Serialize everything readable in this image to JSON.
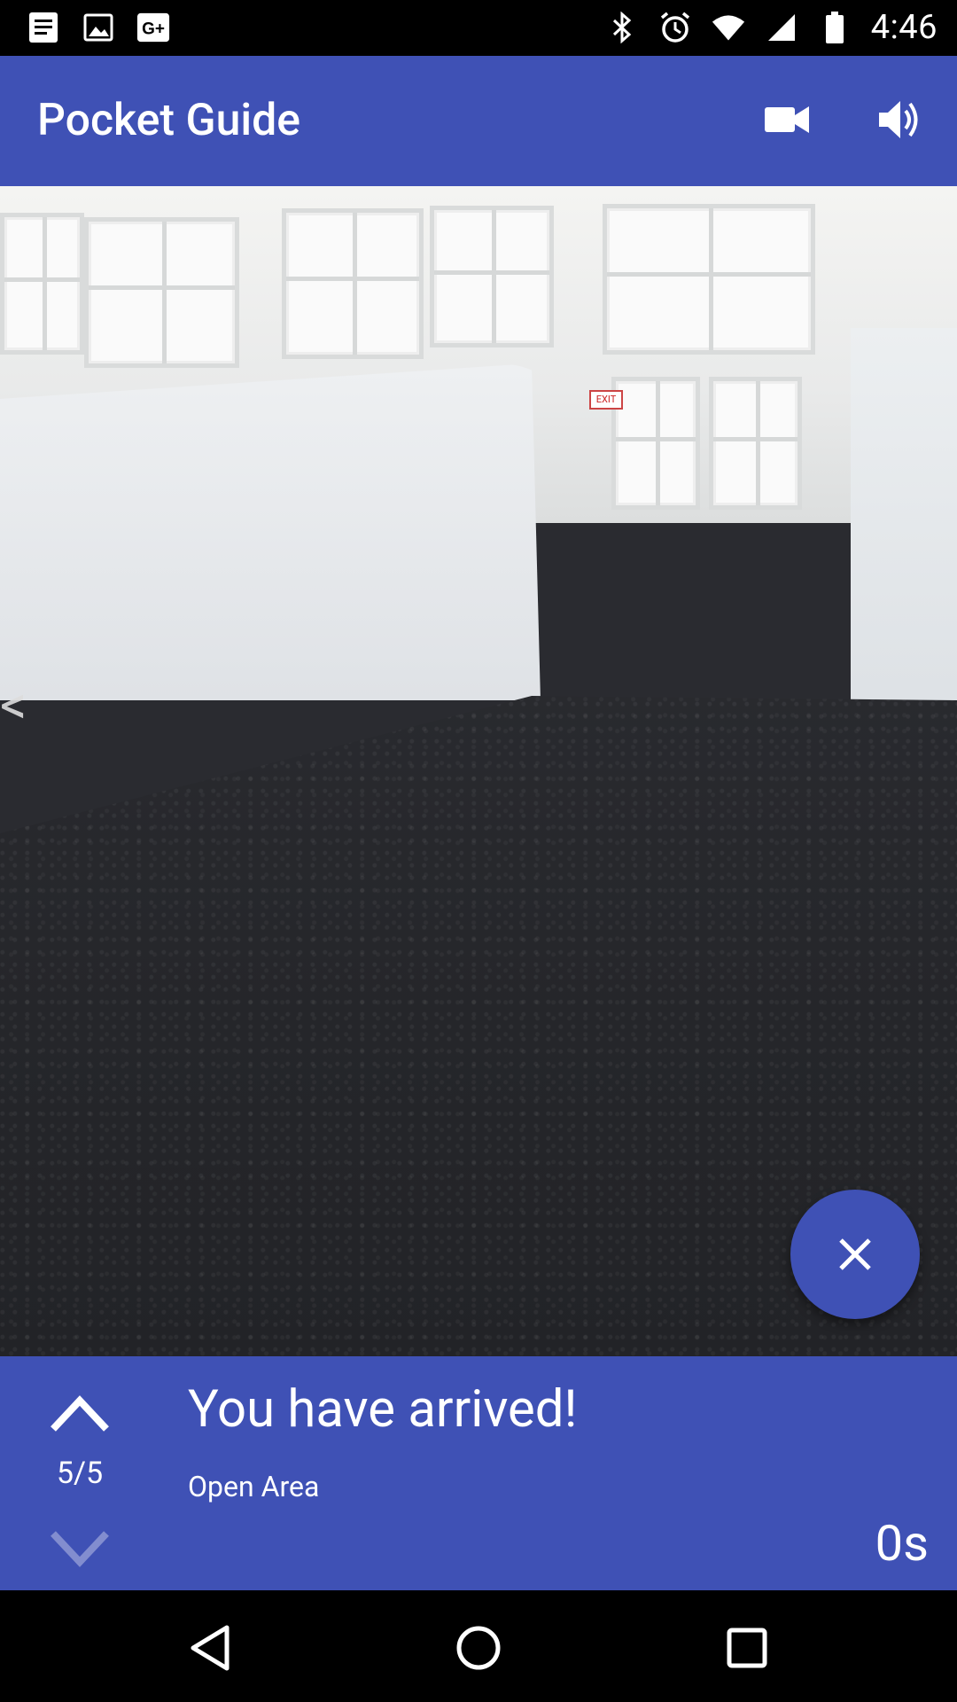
{
  "status_bar": {
    "time": "4:46",
    "left_icons": [
      "notes-icon",
      "image-icon",
      "google-plus-icon"
    ],
    "right_icons": [
      "bluetooth-icon",
      "alarm-icon",
      "wifi-icon",
      "signal-icon",
      "battery-icon"
    ],
    "google_plus_label": "G+"
  },
  "app_bar": {
    "title": "Pocket Guide",
    "actions": [
      "videocam-icon",
      "volume-up-icon"
    ]
  },
  "camera": {
    "exit_sign_text": "EXIT",
    "left_chevron": "<"
  },
  "fab": {
    "icon": "close-icon"
  },
  "panel": {
    "title": "You have arrived!",
    "subtitle": "Open Area",
    "step": "5/5",
    "elapsed": "0s"
  },
  "nav_bar": {
    "buttons": [
      "back-icon",
      "home-icon",
      "recents-icon"
    ]
  },
  "colors": {
    "primary": "#3F51B5",
    "status_bar": "#000000",
    "carpet": "#26272b"
  }
}
